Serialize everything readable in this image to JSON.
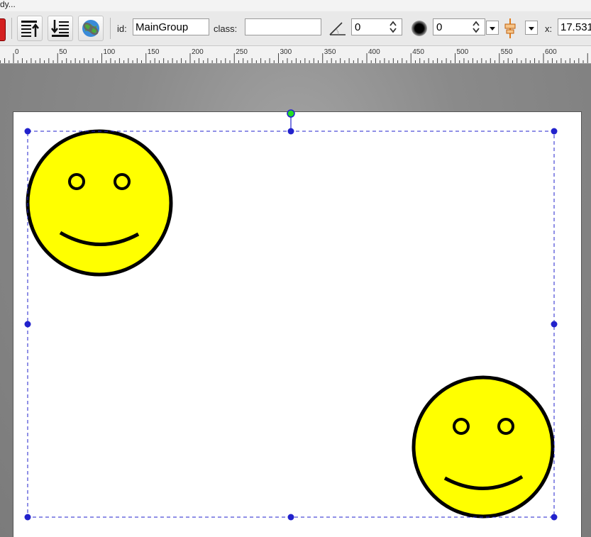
{
  "window": {
    "title_fragment": "dy..."
  },
  "toolbar": {
    "id_label": "id:",
    "id_value": "MainGroup",
    "class_label": "class:",
    "class_value": "",
    "angle_value": "0",
    "blur_value": "0",
    "x_label": "x:",
    "x_value": "17.531",
    "icons": [
      "stop-icon",
      "move-to-top-icon",
      "move-to-bottom-icon",
      "link-icon",
      "angle-icon",
      "blur-icon",
      "align-icon"
    ]
  },
  "ruler": {
    "labels": [
      "0",
      "50",
      "100",
      "150",
      "200",
      "250",
      "300",
      "350",
      "400",
      "450",
      "500",
      "550",
      "600"
    ]
  },
  "canvas": {
    "objects": [
      "smiley-face",
      "smiley-face"
    ],
    "selection": "group selection box",
    "colors": {
      "face_fill": "#ffff00",
      "stroke": "#000000",
      "selection": "#2222cc",
      "rotate_handle": "#22dd22",
      "background": "#ffffff"
    }
  }
}
